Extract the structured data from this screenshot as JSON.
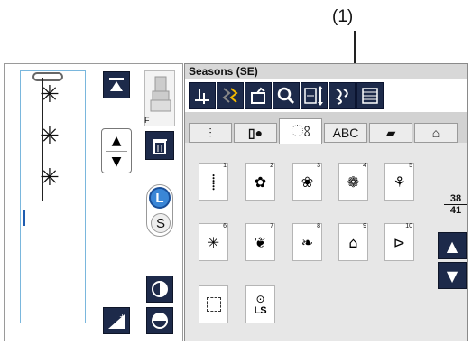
{
  "callout": {
    "label": "(1)"
  },
  "window": {
    "title": "Seasons (SE)"
  },
  "left": {
    "foot_label": "F",
    "size_options": [
      "L",
      "S"
    ]
  },
  "tabs": [
    {
      "name": "tab-stitch",
      "icon": "stitch-icon"
    },
    {
      "name": "tab-buttonhole",
      "icon": "buttonhole-icon"
    },
    {
      "name": "tab-decorative",
      "icon": "decorative-icon",
      "active": true
    },
    {
      "name": "tab-alphabet",
      "label": "ABC"
    },
    {
      "name": "tab-satin",
      "icon": "satin-icon"
    },
    {
      "name": "tab-shirt",
      "icon": "shirt-icon"
    }
  ],
  "patterns": [
    {
      "num": "1"
    },
    {
      "num": "2"
    },
    {
      "num": "3"
    },
    {
      "num": "4"
    },
    {
      "num": "5"
    },
    {
      "num": "6"
    },
    {
      "num": "7"
    },
    {
      "num": "8"
    },
    {
      "num": "9"
    },
    {
      "num": "10"
    }
  ],
  "special": {
    "ls_label": "LS"
  },
  "pager": {
    "current": "38",
    "total": "41"
  }
}
